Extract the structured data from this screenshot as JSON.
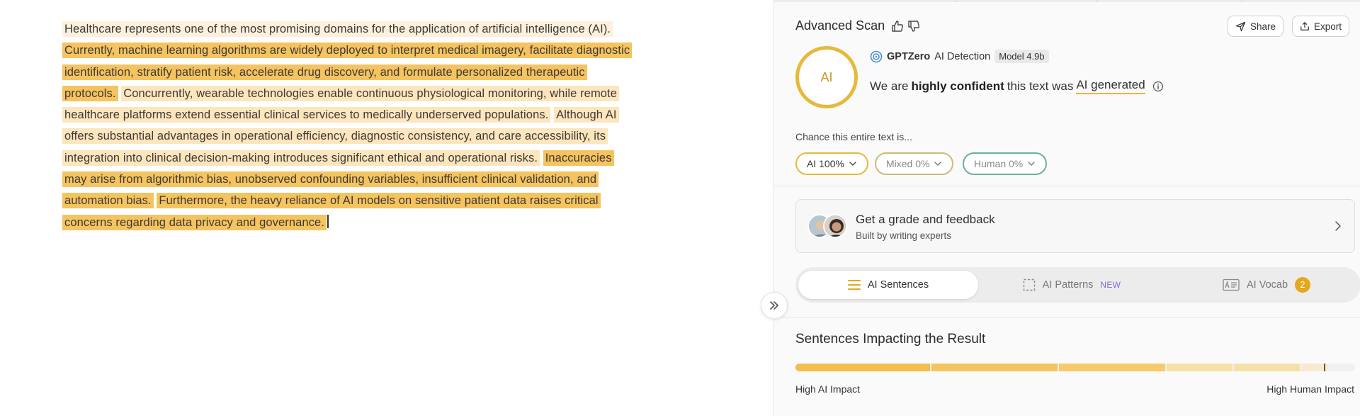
{
  "editor": {
    "sentences": [
      {
        "text": "Healthcare represents one of the most promising domains for the application of artificial intelligence (AI).",
        "level": "faint"
      },
      {
        "text": "Currently, machine learning algorithms are widely deployed to interpret medical imagery, facilitate diagnostic identification, stratify patient risk, accelerate drug discovery, and formulate personalized therapeutic protocols.",
        "level": "high"
      },
      {
        "text": "Concurrently, wearable technologies enable continuous physiological monitoring, while remote healthcare platforms extend essential clinical services to medically underserved populations.",
        "level": "low"
      },
      {
        "text": "Although AI offers substantial advantages in operational efficiency, diagnostic consistency, and care accessibility, its integration into clinical decision-making introduces significant ethical and operational risks.",
        "level": "low"
      },
      {
        "text": "Inaccuracies may arise from algorithmic bias, unobserved confounding variables, insufficient clinical validation, and automation bias.",
        "level": "high"
      },
      {
        "text": "Furthermore, the heavy reliance of AI models on sensitive patient data raises critical concerns regarding data privacy and governance.",
        "level": "high"
      }
    ]
  },
  "header": {
    "title": "Advanced Scan",
    "share_label": "Share",
    "export_label": "Export"
  },
  "result": {
    "ring_label": "AI",
    "brand": "GPTZero",
    "product": "AI Detection",
    "model_badge": "Model 4.9b",
    "confidence_prefix": "We are",
    "confidence_level": "highly confident",
    "confidence_middle": "this text was",
    "verdict": "AI generated",
    "ring_color": "#e7b93b"
  },
  "chance": {
    "label": "Chance this entire text is...",
    "ai": "AI 100%",
    "mixed": "Mixed 0%",
    "human": "Human 0%"
  },
  "grade_card": {
    "title": "Get a grade and feedback",
    "subtitle": "Built by writing experts"
  },
  "tabs": {
    "sentences_label": "AI Sentences",
    "patterns_label": "AI Patterns",
    "patterns_badge": "NEW",
    "vocab_label": "AI Vocab",
    "vocab_count": "2"
  },
  "impact": {
    "title": "Sentences Impacting the Result",
    "left_label": "High AI Impact",
    "right_label": "High Human Impact",
    "segments": [
      {
        "share": 0.24,
        "color": "#f5bd4f"
      },
      {
        "share": 0.225,
        "color": "#f5c460"
      },
      {
        "share": 0.19,
        "color": "#f7ca6a"
      },
      {
        "share": 0.118,
        "color": "#f6dfa8"
      },
      {
        "share": 0.118,
        "color": "#f7dfa9"
      },
      {
        "share": 0.047,
        "color": "#f8ead0"
      }
    ],
    "marker_position": 0.944
  }
}
